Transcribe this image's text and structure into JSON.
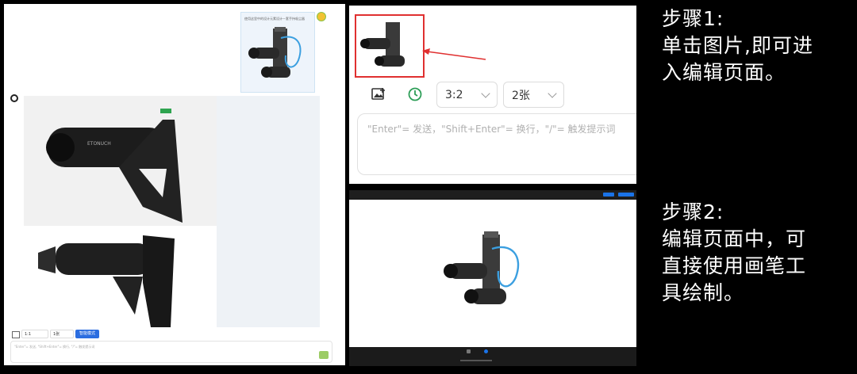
{
  "left": {
    "chat_prompt": "使用这里中的设计元素设计一套手持吸尘器",
    "chat_icon": "bot-avatar-icon",
    "toolbar": {
      "ratio": "1:1",
      "count": "1张",
      "mode_label": "智能模式"
    },
    "input_placeholder": "\"Enter\"= 发送, \"Shift+Enter\"= 换行, \"/\"= 触发提示词",
    "product_brand": "ETONUCH"
  },
  "top_right": {
    "toolbar": {
      "ratio": "3:2",
      "count": "2张"
    },
    "input_placeholder": "\"Enter\"= 发送，\"Shift+Enter\"= 换行，\"/\"= 触发提示词",
    "icons": [
      "image-add-icon",
      "history-icon"
    ]
  },
  "steps": {
    "step1": "步骤1:\n单击图片,即可进\n入编辑页面。",
    "step2": "步骤2:\n编辑页面中，可\n直接使用画笔工\n具绘制。"
  },
  "colors": {
    "highlight": "#e03030",
    "accent": "#1a73e8",
    "panel_bg": "#ffffff"
  }
}
